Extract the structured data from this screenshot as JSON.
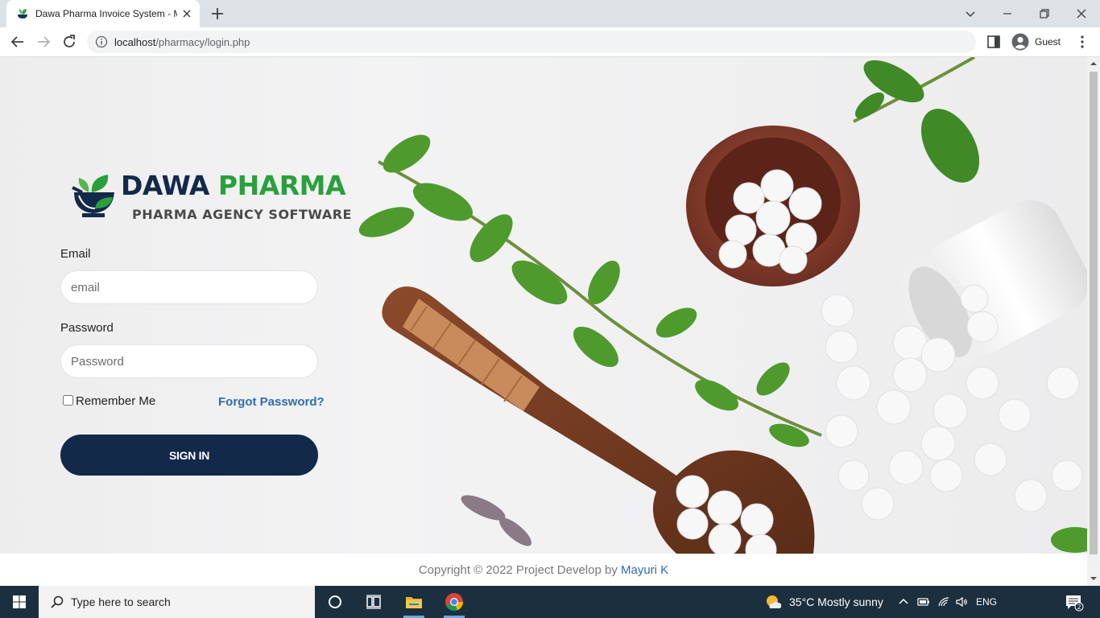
{
  "browser": {
    "tab_title": "Dawa Pharma Invoice System - M",
    "url_host": "localhost",
    "url_path": "/pharmacy/login.php",
    "profile_label": "Guest"
  },
  "brand": {
    "name_part1": "DAWA",
    "name_part2": "PHARMA",
    "tagline": "PHARMA AGENCY SOFTWARE",
    "colors": {
      "navy": "#12294a",
      "green": "#2aa03c",
      "link": "#2d6cb2"
    }
  },
  "login": {
    "email_label": "Email",
    "email_placeholder": "email",
    "email_value": "",
    "password_label": "Password",
    "password_placeholder": "Password",
    "password_value": "",
    "remember_label": "Remember Me",
    "forgot_label": "Forgot Password?",
    "signin_label": "SIGN IN"
  },
  "footer": {
    "text": "Copyright © 2022 Project Develop by ",
    "author": "Mayuri K"
  },
  "taskbar": {
    "search_placeholder": "Type here to search",
    "weather": "35°C  Mostly sunny",
    "language": "ENG",
    "notification_count": "2",
    "icons": [
      "windows-start-icon",
      "search-icon",
      "cortana-icon",
      "task-view-icon",
      "file-explorer-icon",
      "chrome-icon"
    ]
  }
}
